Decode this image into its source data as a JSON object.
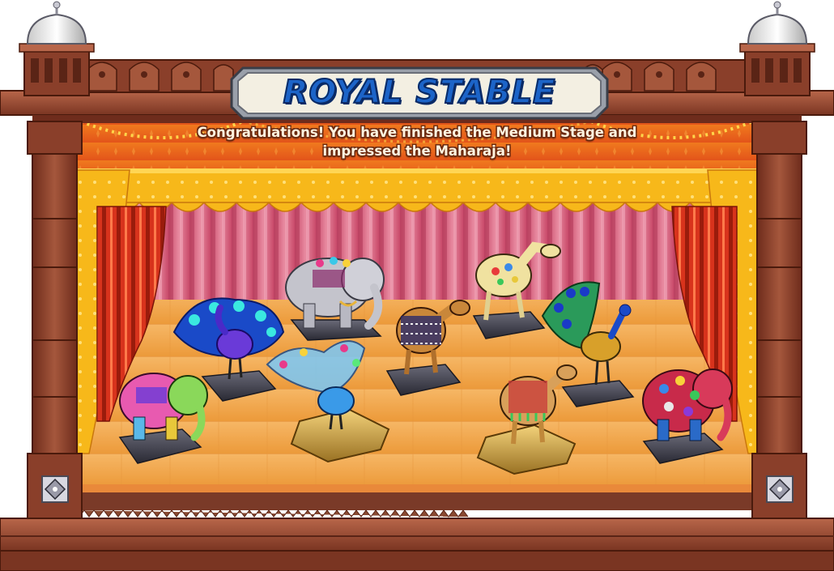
{
  "banner": {
    "title": "ROYAL STABLE"
  },
  "message": {
    "line1": "Congratulations! You have finished the Medium Stage and",
    "line2": "impressed the Maharaja!"
  },
  "colors": {
    "frame_wood": "#8a3f2a",
    "frame_dark": "#5a2416",
    "curtain_red": "#d8331c",
    "valance_yellow": "#f7b81a",
    "floor": "#f2a64a",
    "title_blue": "#1c64c8"
  },
  "statues": [
    {
      "kind": "elephant",
      "style": "grey-jeweled"
    },
    {
      "kind": "peacock",
      "style": "blue-jeweled"
    },
    {
      "kind": "camel",
      "style": "patterned-yellow"
    },
    {
      "kind": "camel",
      "style": "beaded-brown"
    },
    {
      "kind": "peacock",
      "style": "classic"
    },
    {
      "kind": "elephant",
      "style": "rainbow"
    },
    {
      "kind": "peacock",
      "style": "pastel-feathered"
    },
    {
      "kind": "camel",
      "style": "tasseled"
    },
    {
      "kind": "elephant",
      "style": "mosaic"
    }
  ],
  "corner_icons": [
    "diamond-ornament-icon",
    "diamond-ornament-icon"
  ]
}
